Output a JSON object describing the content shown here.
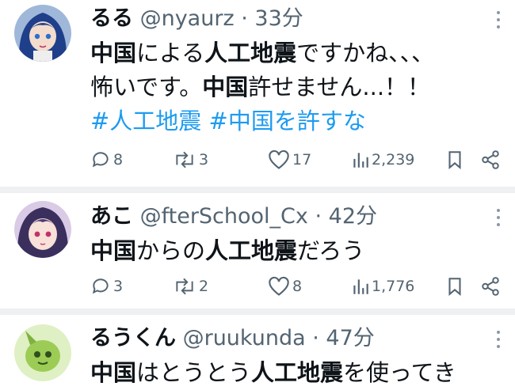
{
  "posts": [
    {
      "name": "るる",
      "handle": "@nyaurz",
      "sep": "·",
      "time": "33分",
      "lines": [
        [
          {
            "t": "中国",
            "b": true
          },
          {
            "t": "による",
            "b": false
          },
          {
            "t": "人工地震",
            "b": true
          },
          {
            "t": "ですかね、、、",
            "b": false
          }
        ],
        [
          {
            "t": "怖いです。",
            "b": false
          },
          {
            "t": "中国",
            "b": true
          },
          {
            "t": "許せません...！！",
            "b": false
          }
        ]
      ],
      "hashtags": "#人工地震 #中国を許すな",
      "counts": {
        "replies": "8",
        "reposts": "3",
        "likes": "17",
        "views": "2,239"
      }
    },
    {
      "name": "あこ",
      "handle": "@fterSchool_Cx",
      "sep": "·",
      "time": "42分",
      "lines": [
        [
          {
            "t": "中国",
            "b": true
          },
          {
            "t": "からの",
            "b": false
          },
          {
            "t": "人工地震",
            "b": true
          },
          {
            "t": "だろう",
            "b": false
          }
        ]
      ],
      "counts": {
        "replies": "3",
        "reposts": "2",
        "likes": "8",
        "views": "1,776"
      }
    },
    {
      "name": "るうくん",
      "handle": "@ruukunda",
      "sep": "·",
      "time": "47分",
      "lines": [
        [
          {
            "t": "中国",
            "b": true
          },
          {
            "t": "はとうとう",
            "b": false
          },
          {
            "t": "人工地震",
            "b": true
          },
          {
            "t": "を使ってき",
            "b": false
          }
        ]
      ]
    }
  ],
  "colors": {
    "accent": "#1d9bf0",
    "muted": "#536471",
    "text": "#0f1419"
  },
  "icons": {
    "reply": "reply-icon",
    "repost": "repost-icon",
    "like": "like-icon",
    "views": "views-icon",
    "bookmark": "bookmark-icon",
    "share": "share-icon",
    "more": "more-icon"
  }
}
